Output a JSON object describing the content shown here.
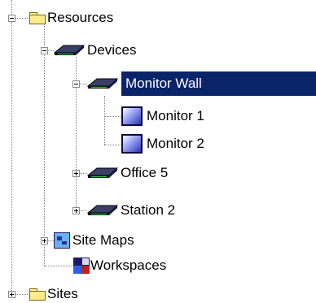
{
  "tree": {
    "resources_label": "Resources",
    "devices_label": "Devices",
    "monitor_wall_label": "Monitor Wall",
    "monitor1_label": "Monitor 1",
    "monitor2_label": "Monitor 2",
    "office5_label": "Office 5",
    "station2_label": "Station 2",
    "sitemaps_label": "Site Maps",
    "workspaces_label": "Workspaces",
    "sites_label": "Sites"
  },
  "colors": {
    "selection_bg": "#0a246a",
    "selection_text": "#ffffff"
  }
}
